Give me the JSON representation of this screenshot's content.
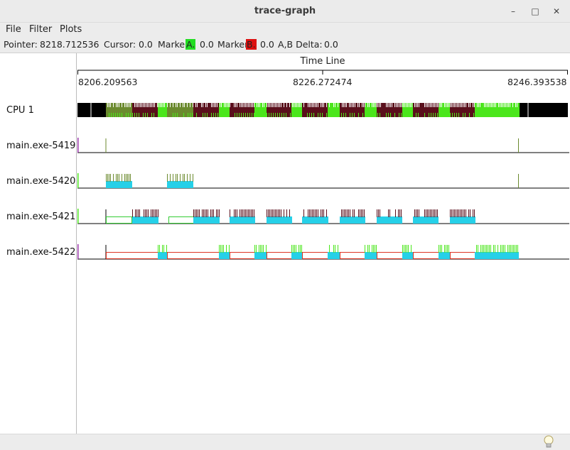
{
  "window": {
    "title": "trace-graph"
  },
  "menu": [
    "File",
    "Filter",
    "Plots"
  ],
  "status": {
    "pointer_label": "Pointer:",
    "pointer_value": "8218.712536",
    "cursor_label": "Cursor:",
    "cursor_value": "0.0",
    "marker_a_label": "Marker",
    "marker_a_tag": "A.",
    "marker_a_value": "0.0",
    "marker_b_label": "Marker",
    "marker_b_tag": "B.",
    "marker_b_value": "0.0",
    "delta_label": "A,B Delta:",
    "delta_value": "0.0"
  },
  "timeline": {
    "title": "Time Line",
    "start": "8206.209563",
    "mid": "8226.272474",
    "end": "8246.393538"
  },
  "rows": [
    "CPU 1",
    "main.exe-5419",
    "main.exe-5420",
    "main.exe-5421",
    "main.exe-5422"
  ],
  "colors": {
    "marker_a": "#22dd22",
    "marker_b": "#dd1111",
    "cpu_idle": "#000000",
    "cpu_task_olive": "#6b8a2e",
    "cpu_task_maroon": "#5a0f1c",
    "cpu_task_green": "#4be61c",
    "run_cyan": "#26d0e8",
    "wait_red": "#dd3322",
    "wait_green": "#33cc33"
  },
  "icons": [
    "minimize-icon",
    "maximize-icon",
    "close-icon",
    "lightbulb-icon"
  ]
}
